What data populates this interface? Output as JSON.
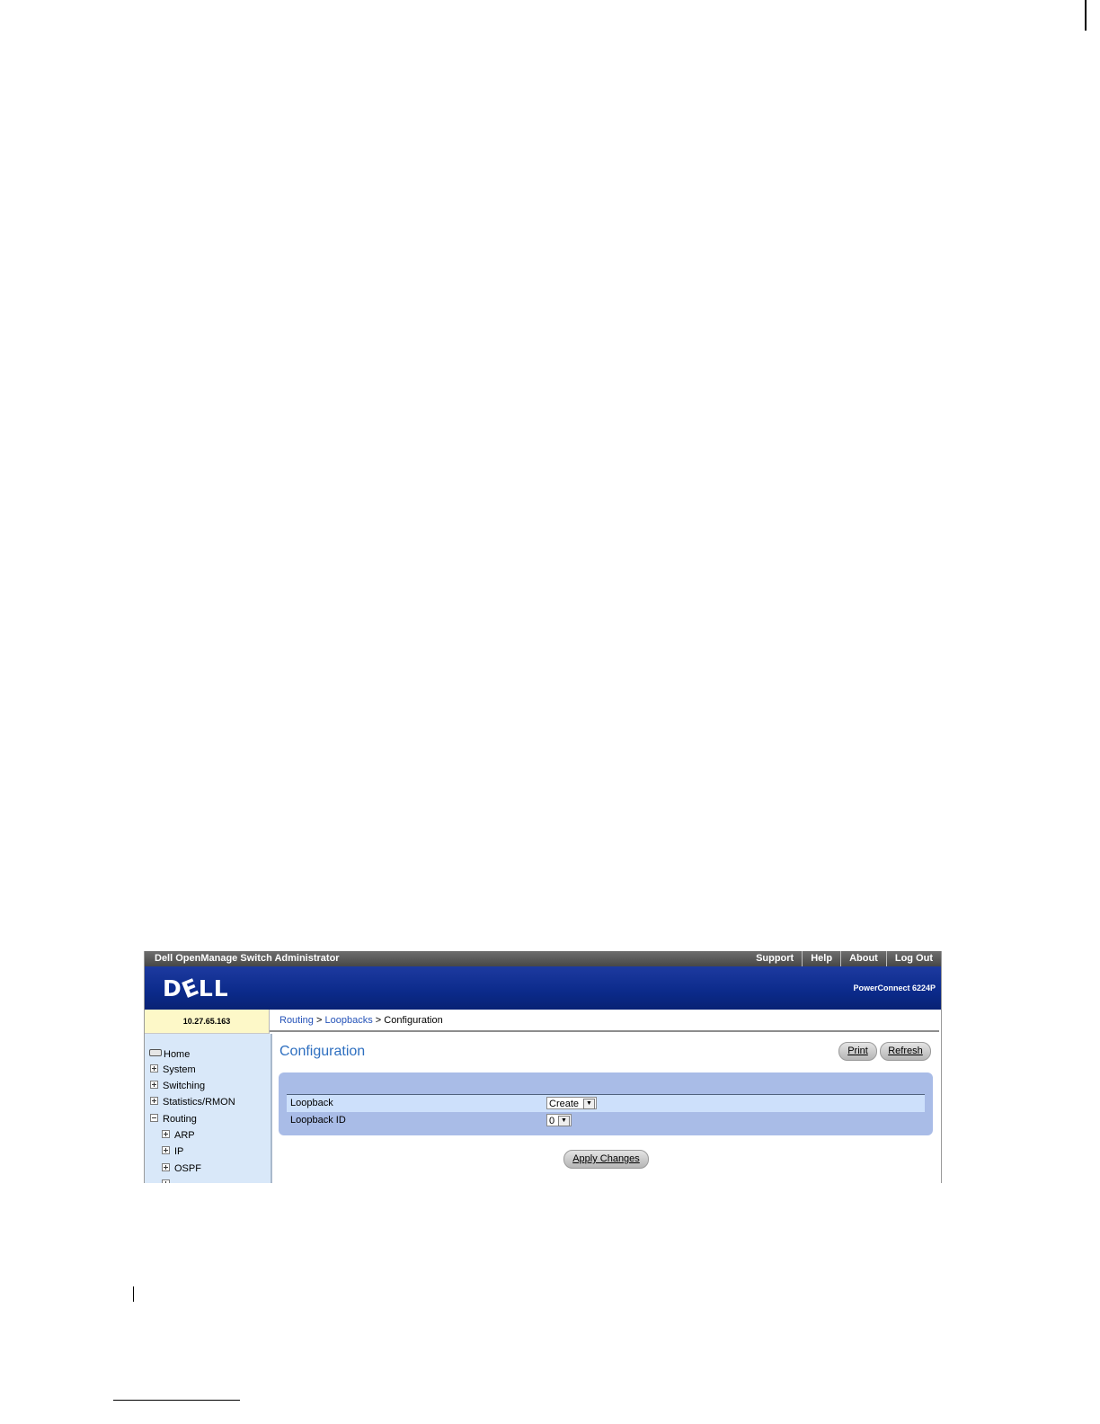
{
  "app": {
    "title": "Dell OpenManage Switch Administrator",
    "nav": [
      "Support",
      "Help",
      "About",
      "Log Out"
    ],
    "logo_text": "DELL",
    "product": "PowerConnect 6224P",
    "ip_address": "10.27.65.163"
  },
  "breadcrumb": {
    "items": [
      "Routing",
      "Loopbacks"
    ],
    "separator": ">",
    "current": "Configuration"
  },
  "sidebar": {
    "items": [
      {
        "label": "Home",
        "icon": "home-icon"
      },
      {
        "label": "System",
        "icon": "expand-icon"
      },
      {
        "label": "Switching",
        "icon": "expand-icon"
      },
      {
        "label": "Statistics/RMON",
        "icon": "expand-icon"
      },
      {
        "label": "Routing",
        "icon": "collapse-icon"
      },
      {
        "label": "ARP",
        "icon": "expand-icon"
      },
      {
        "label": "IP",
        "icon": "expand-icon"
      },
      {
        "label": "OSPF",
        "icon": "expand-icon"
      }
    ]
  },
  "page": {
    "title": "Configuration",
    "print_label": "Print",
    "refresh_label": "Refresh",
    "apply_label": "Apply Changes"
  },
  "form": {
    "rows": [
      {
        "label": "Loopback",
        "value": "Create"
      },
      {
        "label": "Loopback ID",
        "value": "0"
      }
    ]
  },
  "colors": {
    "banner": "#0b2a8a",
    "title_blue": "#2e6fc0",
    "link_blue": "#2452b8",
    "panel": "#a9bce7",
    "row_highlight": "#cde0fb",
    "sidebar": "#d9e8f9",
    "ip_bar": "#fdf8c8"
  }
}
